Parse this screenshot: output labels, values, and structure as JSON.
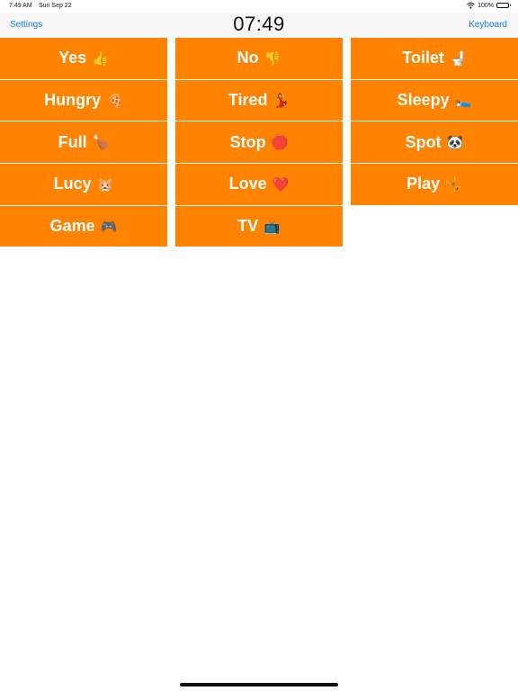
{
  "status_bar": {
    "time": "7:49 AM",
    "date": "Sun Sep 22",
    "battery": "100%"
  },
  "nav": {
    "left_label": "Settings",
    "title": "07:49",
    "right_label": "Keyboard"
  },
  "tiles": {
    "col1": [
      {
        "label": "Yes",
        "emoji": "👍",
        "icon": "thumbs-up-icon"
      },
      {
        "label": "Hungry",
        "emoji": "🍕",
        "icon": "pizza-icon"
      },
      {
        "label": "Full",
        "emoji": "🍗",
        "icon": "drumstick-icon"
      },
      {
        "label": "Lucy",
        "emoji": "🐹",
        "icon": "hamster-icon"
      },
      {
        "label": "Game",
        "emoji": "🎮",
        "icon": "game-controller-icon"
      }
    ],
    "col2": [
      {
        "label": "No",
        "emoji": "👎",
        "icon": "thumbs-down-icon"
      },
      {
        "label": "Tired",
        "emoji": "💃",
        "icon": "dancer-icon"
      },
      {
        "label": "Stop",
        "emoji": "🛑",
        "icon": "stop-sign-icon"
      },
      {
        "label": "Love",
        "emoji": "❤️",
        "icon": "heart-icon"
      },
      {
        "label": "TV",
        "emoji": "📺",
        "icon": "television-icon"
      }
    ],
    "col3": [
      {
        "label": "Toilet",
        "emoji": "🚽",
        "icon": "toilet-icon"
      },
      {
        "label": "Sleepy",
        "emoji": "🛌",
        "icon": "bed-icon"
      },
      {
        "label": "Spot",
        "emoji": "🐼",
        "icon": "panda-icon"
      },
      {
        "label": "Play",
        "emoji": "🤸",
        "icon": "cartwheel-icon"
      }
    ]
  },
  "colors": {
    "tile": "#ff8200",
    "link": "#1b7de2"
  }
}
